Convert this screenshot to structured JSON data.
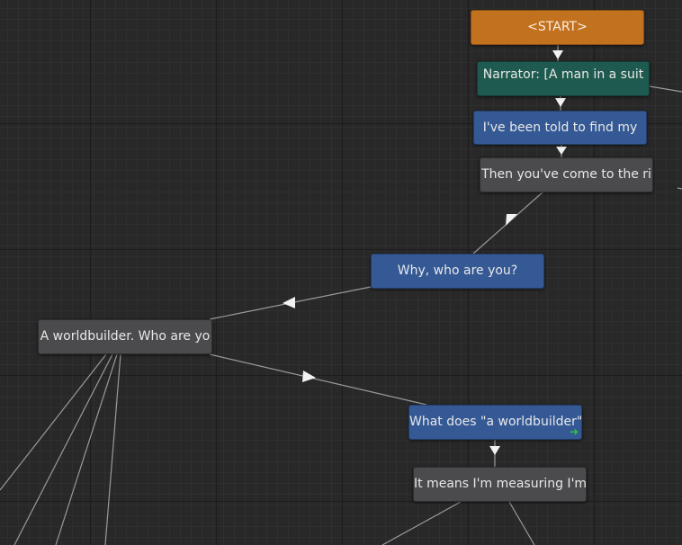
{
  "nodes": {
    "start": {
      "label": "<START>"
    },
    "narrator": {
      "label": "Narrator: [A man in a suit"
    },
    "told_to_find": {
      "label": "I've been told to find my"
    },
    "come_to_right": {
      "label": "Then you've come to the ri"
    },
    "who_are_you": {
      "label": "Why, who are you?"
    },
    "worldbuilder": {
      "label": "A worldbuilder. Who are yo"
    },
    "what_does": {
      "label": "What does \"a worldbuilder\""
    },
    "it_means": {
      "label": "It means I'm measuring I'm"
    }
  },
  "icons": {
    "exit": "arrow-right-icon"
  },
  "colors": {
    "start_node": "#c2711f",
    "narrator_node": "#1e5a4f",
    "player_node": "#345995",
    "npc_node": "#4b4b4e",
    "exit_arrow": "#35c43a",
    "edge": "#9a9a9a"
  }
}
